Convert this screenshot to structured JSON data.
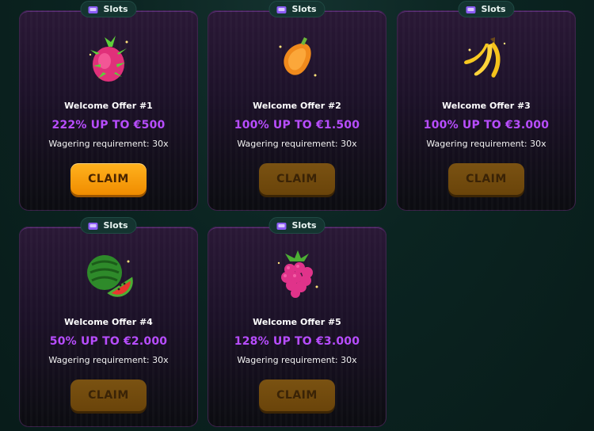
{
  "offers": [
    {
      "category": "Slots",
      "title": "Welcome Offer #1",
      "amount": "222% UP TO €500",
      "wagering": "Wagering requirement: 30x",
      "claim": "CLAIM",
      "icon": "dragon-fruit-icon"
    },
    {
      "category": "Slots",
      "title": "Welcome Offer #2",
      "amount": "100% UP TO €1.500",
      "wagering": "Wagering requirement: 30x",
      "claim": "CLAIM",
      "icon": "papaya-icon"
    },
    {
      "category": "Slots",
      "title": "Welcome Offer #3",
      "amount": "100% UP TO €3.000",
      "wagering": "Wagering requirement: 30x",
      "claim": "CLAIM",
      "icon": "banana-icon"
    },
    {
      "category": "Slots",
      "title": "Welcome Offer #4",
      "amount": "50% UP TO €2.000",
      "wagering": "Wagering requirement: 30x",
      "claim": "CLAIM",
      "icon": "watermelon-icon"
    },
    {
      "category": "Slots",
      "title": "Welcome Offer #5",
      "amount": "128% UP TO €3.000",
      "wagering": "Wagering requirement: 30x",
      "claim": "CLAIM",
      "icon": "raspberry-icon"
    }
  ],
  "colors": {
    "amount": "#b84dff",
    "claim_active": "#f59a0a",
    "claim_dim": "#6e470c",
    "card_bg": "#1c1128"
  }
}
